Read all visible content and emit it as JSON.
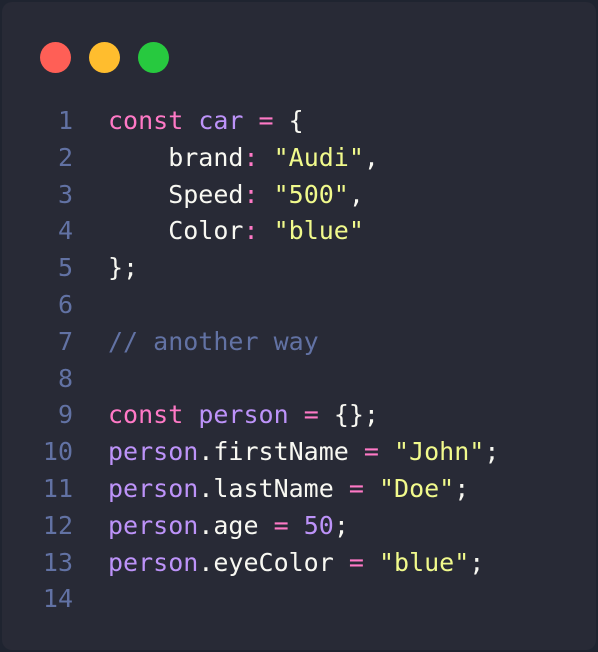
{
  "window": {
    "buttons": [
      {
        "name": "close",
        "color": "#ff5f56"
      },
      {
        "name": "minimize",
        "color": "#ffbd2e"
      },
      {
        "name": "maximize",
        "color": "#27c93f"
      }
    ]
  },
  "colors": {
    "background": "#282a36",
    "line_number": "#6272a4",
    "keyword": "#ff79c6",
    "variable": "#bd93f9",
    "string": "#f1fa8c",
    "comment": "#6272a4",
    "text": "#f8f8f2"
  },
  "code": {
    "lines": [
      {
        "number": "1",
        "tokens": [
          {
            "t": "const",
            "k": "keyword"
          },
          {
            "t": " ",
            "k": "space"
          },
          {
            "t": "car",
            "k": "var"
          },
          {
            "t": " ",
            "k": "space"
          },
          {
            "t": "=",
            "k": "op"
          },
          {
            "t": " ",
            "k": "space"
          },
          {
            "t": "{",
            "k": "punct"
          }
        ]
      },
      {
        "number": "2",
        "tokens": [
          {
            "t": "    brand",
            "k": "prop"
          },
          {
            "t": ":",
            "k": "op"
          },
          {
            "t": " ",
            "k": "space"
          },
          {
            "t": "\"Audi\"",
            "k": "string"
          },
          {
            "t": ",",
            "k": "punct"
          }
        ]
      },
      {
        "number": "3",
        "tokens": [
          {
            "t": "    Speed",
            "k": "prop"
          },
          {
            "t": ":",
            "k": "op"
          },
          {
            "t": " ",
            "k": "space"
          },
          {
            "t": "\"500\"",
            "k": "string"
          },
          {
            "t": ",",
            "k": "punct"
          }
        ]
      },
      {
        "number": "4",
        "tokens": [
          {
            "t": "    Color",
            "k": "prop"
          },
          {
            "t": ":",
            "k": "op"
          },
          {
            "t": " ",
            "k": "space"
          },
          {
            "t": "\"blue\"",
            "k": "string"
          }
        ]
      },
      {
        "number": "5",
        "tokens": [
          {
            "t": "};",
            "k": "punct"
          }
        ]
      },
      {
        "number": "6",
        "tokens": []
      },
      {
        "number": "7",
        "tokens": [
          {
            "t": "// another way",
            "k": "comment"
          }
        ]
      },
      {
        "number": "8",
        "tokens": []
      },
      {
        "number": "9",
        "tokens": [
          {
            "t": "const",
            "k": "keyword"
          },
          {
            "t": " ",
            "k": "space"
          },
          {
            "t": "person",
            "k": "var"
          },
          {
            "t": " ",
            "k": "space"
          },
          {
            "t": "=",
            "k": "op"
          },
          {
            "t": " ",
            "k": "space"
          },
          {
            "t": "{};",
            "k": "punct"
          }
        ]
      },
      {
        "number": "10",
        "tokens": [
          {
            "t": "person",
            "k": "var"
          },
          {
            "t": ".firstName",
            "k": "prop"
          },
          {
            "t": " ",
            "k": "space"
          },
          {
            "t": "=",
            "k": "op"
          },
          {
            "t": " ",
            "k": "space"
          },
          {
            "t": "\"John\"",
            "k": "string"
          },
          {
            "t": ";",
            "k": "punct"
          }
        ]
      },
      {
        "number": "11",
        "tokens": [
          {
            "t": "person",
            "k": "var"
          },
          {
            "t": ".lastName",
            "k": "prop"
          },
          {
            "t": " ",
            "k": "space"
          },
          {
            "t": "=",
            "k": "op"
          },
          {
            "t": " ",
            "k": "space"
          },
          {
            "t": "\"Doe\"",
            "k": "string"
          },
          {
            "t": ";",
            "k": "punct"
          }
        ]
      },
      {
        "number": "12",
        "tokens": [
          {
            "t": "person",
            "k": "var"
          },
          {
            "t": ".age",
            "k": "prop"
          },
          {
            "t": " ",
            "k": "space"
          },
          {
            "t": "=",
            "k": "op"
          },
          {
            "t": " ",
            "k": "space"
          },
          {
            "t": "50",
            "k": "number"
          },
          {
            "t": ";",
            "k": "punct"
          }
        ]
      },
      {
        "number": "13",
        "tokens": [
          {
            "t": "person",
            "k": "var"
          },
          {
            "t": ".eyeColor",
            "k": "prop"
          },
          {
            "t": " ",
            "k": "space"
          },
          {
            "t": "=",
            "k": "op"
          },
          {
            "t": " ",
            "k": "space"
          },
          {
            "t": "\"blue\"",
            "k": "string"
          },
          {
            "t": ";",
            "k": "punct"
          }
        ]
      },
      {
        "number": "14",
        "tokens": []
      }
    ]
  }
}
